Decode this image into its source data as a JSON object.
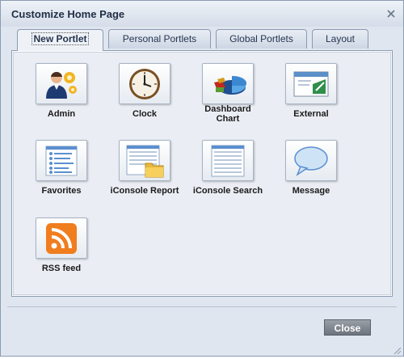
{
  "dialog": {
    "title": "Customize Home Page",
    "close_icon": "close-icon"
  },
  "tabs": [
    {
      "label": "New Portlet",
      "active": true
    },
    {
      "label": "Personal Portlets",
      "active": false
    },
    {
      "label": "Global Portlets",
      "active": false
    },
    {
      "label": "Layout",
      "active": false
    }
  ],
  "portlets": [
    {
      "label": "Admin",
      "icon": "admin-gears-person-icon"
    },
    {
      "label": "Clock",
      "icon": "clock-icon"
    },
    {
      "label": "Dashboard Chart",
      "icon": "pie-chart-icon"
    },
    {
      "label": "External",
      "icon": "external-window-icon"
    },
    {
      "label": "Favorites",
      "icon": "favorites-list-icon"
    },
    {
      "label": "iConsole Report",
      "icon": "report-folder-icon"
    },
    {
      "label": "iConsole Search",
      "icon": "search-document-icon"
    },
    {
      "label": "Message",
      "icon": "speech-bubble-icon"
    },
    {
      "label": "RSS feed",
      "icon": "rss-icon"
    }
  ],
  "footer": {
    "close_label": "Close"
  },
  "colors": {
    "dialog_bg": "#dfe6ef",
    "border": "#8b9bb1",
    "panel_bg": "#eaeef4",
    "close_button": "#7d838b",
    "rss_orange": "#f07d1e"
  }
}
